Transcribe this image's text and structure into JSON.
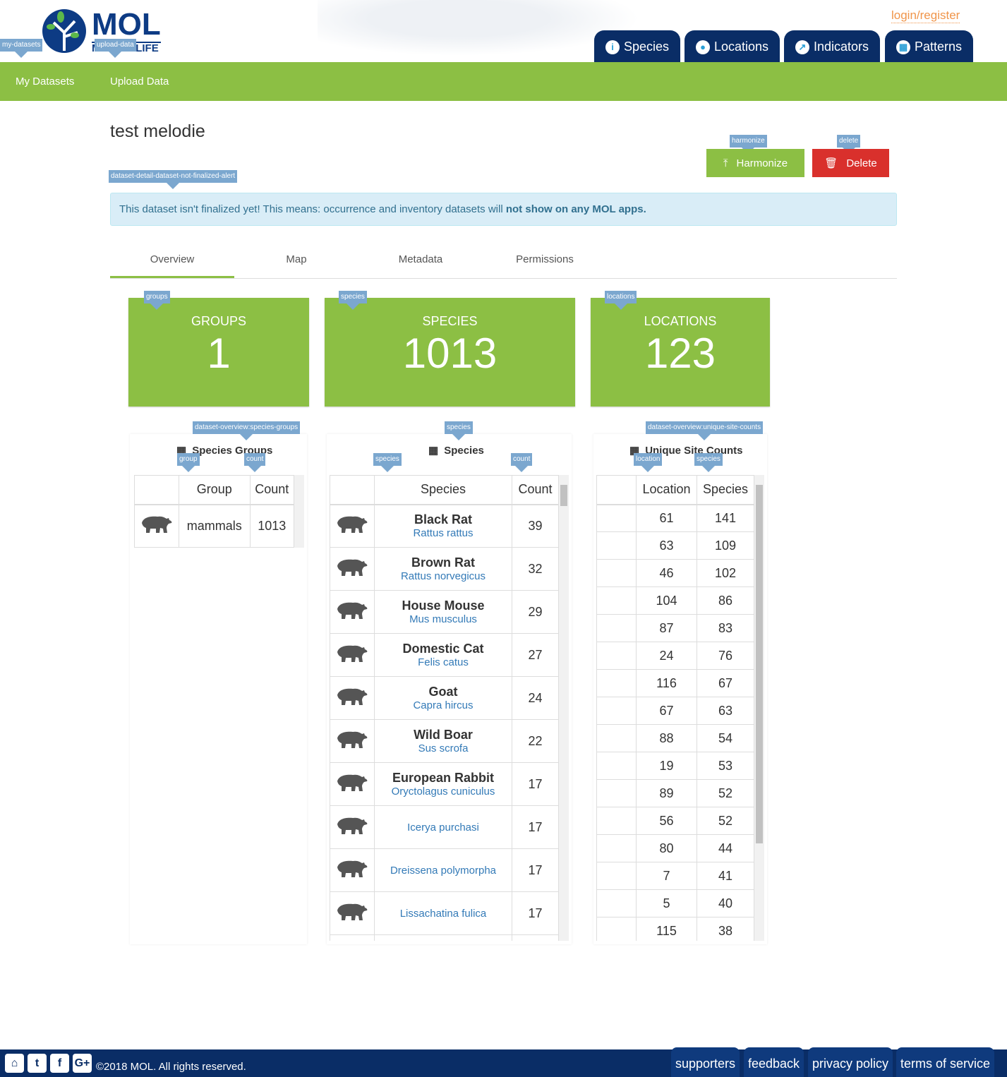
{
  "header": {
    "logo_top": "MOL",
    "logo_bottom": "MAP OF LIFE",
    "login": "login/register",
    "apps": [
      {
        "label": "Species",
        "icon": "info-icon"
      },
      {
        "label": "Locations",
        "icon": "map-pin-icon"
      },
      {
        "label": "Indicators",
        "icon": "chart-icon"
      },
      {
        "label": "Patterns",
        "icon": "grid-globe-icon"
      }
    ]
  },
  "nav": {
    "my_datasets": "My Datasets",
    "upload_data": "Upload Data",
    "tag_my": "my-datasets",
    "tag_upload": "upload-data"
  },
  "dataset": {
    "title": "test melodie",
    "harmonize": "Harmonize",
    "delete": "Delete",
    "tag_harmonize": "harmonize",
    "tag_delete": "delete",
    "alert_tag": "dataset-detail-dataset-not-finalized-alert",
    "alert_text": "This dataset isn't finalized yet! This means: occurrence and inventory datasets will ",
    "alert_bold": "not show on any MOL apps."
  },
  "tabs": [
    "Overview",
    "Map",
    "Metadata",
    "Permissions"
  ],
  "cards": [
    {
      "tag": "groups",
      "label": "GROUPS",
      "value": "1"
    },
    {
      "tag": "species",
      "label": "SPECIES",
      "value": "1013"
    },
    {
      "tag": "locations",
      "label": "LOCATIONS",
      "value": "123"
    }
  ],
  "groups_table": {
    "tag": "dataset-overview:species-groups",
    "title": "Species Groups",
    "col_tags": [
      "group",
      "count"
    ],
    "headers": [
      "Group",
      "Count"
    ],
    "rows": [
      [
        "mammals",
        "1013"
      ]
    ]
  },
  "species_table": {
    "tag": "species",
    "title": "Species",
    "col_tags": [
      "species",
      "count"
    ],
    "headers": [
      "Species",
      "Count"
    ],
    "rows": [
      [
        "Black Rat",
        "Rattus rattus",
        "39"
      ],
      [
        "Brown Rat",
        "Rattus norvegicus",
        "32"
      ],
      [
        "House Mouse",
        "Mus musculus",
        "29"
      ],
      [
        "Domestic Cat",
        "Felis catus",
        "27"
      ],
      [
        "Goat",
        "Capra hircus",
        "24"
      ],
      [
        "Wild Boar",
        "Sus scrofa",
        "22"
      ],
      [
        "European Rabbit",
        "Oryctolagus cuniculus",
        "17"
      ],
      [
        "",
        "Icerya purchasi",
        "17"
      ],
      [
        "",
        "Dreissena polymorpha",
        "17"
      ],
      [
        "",
        "Lissachatina fulica",
        "17"
      ]
    ]
  },
  "sites_table": {
    "tag": "dataset-overview:unique-site-counts",
    "title": "Unique Site Counts",
    "col_tags": [
      "location",
      "species"
    ],
    "headers": [
      "Location",
      "Species"
    ],
    "rows": [
      [
        "61",
        "141"
      ],
      [
        "63",
        "109"
      ],
      [
        "46",
        "102"
      ],
      [
        "104",
        "86"
      ],
      [
        "87",
        "83"
      ],
      [
        "24",
        "76"
      ],
      [
        "116",
        "67"
      ],
      [
        "67",
        "63"
      ],
      [
        "88",
        "54"
      ],
      [
        "19",
        "53"
      ],
      [
        "89",
        "52"
      ],
      [
        "56",
        "52"
      ],
      [
        "80",
        "44"
      ],
      [
        "7",
        "41"
      ],
      [
        "5",
        "40"
      ],
      [
        "115",
        "38"
      ]
    ]
  },
  "footer": {
    "copyright": "©2018 MOL. All rights reserved.",
    "links": [
      "supporters",
      "feedback",
      "privacy policy",
      "terms of service"
    ],
    "social": [
      "github-icon",
      "twitter-icon",
      "facebook-icon",
      "google-plus-icon"
    ]
  },
  "colors": {
    "green": "#8cbf44",
    "navy": "#0a2d66",
    "red": "#d9302c",
    "orange": "#f0954a"
  }
}
